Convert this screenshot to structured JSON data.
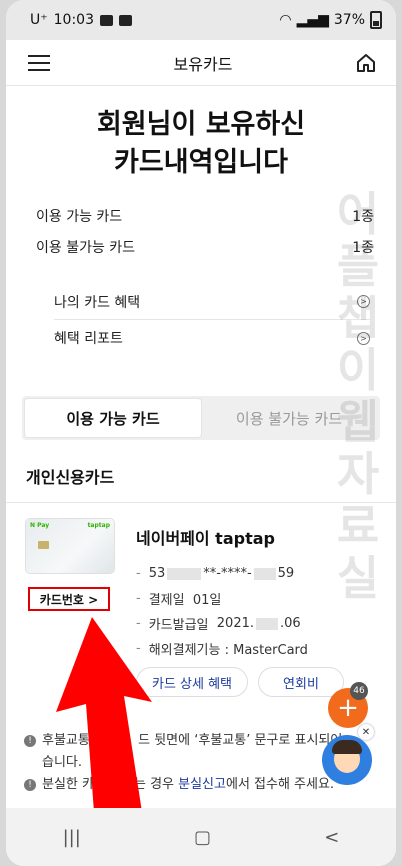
{
  "status_bar": {
    "carrier": "U⁺",
    "time": "10:03",
    "battery": "37%"
  },
  "header": {
    "title": "보유카드"
  },
  "headline": {
    "line1": "회원님이 보유하신",
    "line2": "카드내역입니다"
  },
  "summary": [
    {
      "label": "이용 가능 카드",
      "value": "1종"
    },
    {
      "label": "이용 불가능 카드",
      "value": "1종"
    }
  ],
  "links": [
    {
      "label": "나의 카드 혜택"
    },
    {
      "label": "혜택 리포트"
    }
  ],
  "tabs": [
    {
      "label": "이용 가능 카드",
      "active": true
    },
    {
      "label": "이용 불가능 카드",
      "active": false
    }
  ],
  "section_title": "개인신용카드",
  "card": {
    "image_label_left": "N Pay",
    "image_label_right": "taptap",
    "number_button": "카드번호 >",
    "name": "네이버페이 taptap",
    "number_prefix": "53",
    "number_middle": "**-****-",
    "number_suffix": "59",
    "billing_label": "결제일",
    "billing_value": "01일",
    "issue_label": "카드발급일",
    "issue_prefix": "2021.",
    "issue_suffix": ".06",
    "overseas": "해외결제기능 : MasterCard",
    "benefit_button": "카드 상세 혜택",
    "fee_button": "연회비"
  },
  "fab": {
    "badge": "46",
    "symbol": "+"
  },
  "notice": {
    "line1": "후불교통",
    "line1_b": "드 뒷면에 ‘후불교통’ 문구로 표시되어",
    "line1_c": "습니다.",
    "line2_a": "분실한 카드가 있는 경우 ",
    "line2_link": "분실신고",
    "line2_b": "에서 접수해 주세요."
  },
  "watermark": "어플챕이웹자료실",
  "colors": {
    "accent": "#f26b1d",
    "link": "#1c3a9c",
    "highlight": "#e00000"
  }
}
